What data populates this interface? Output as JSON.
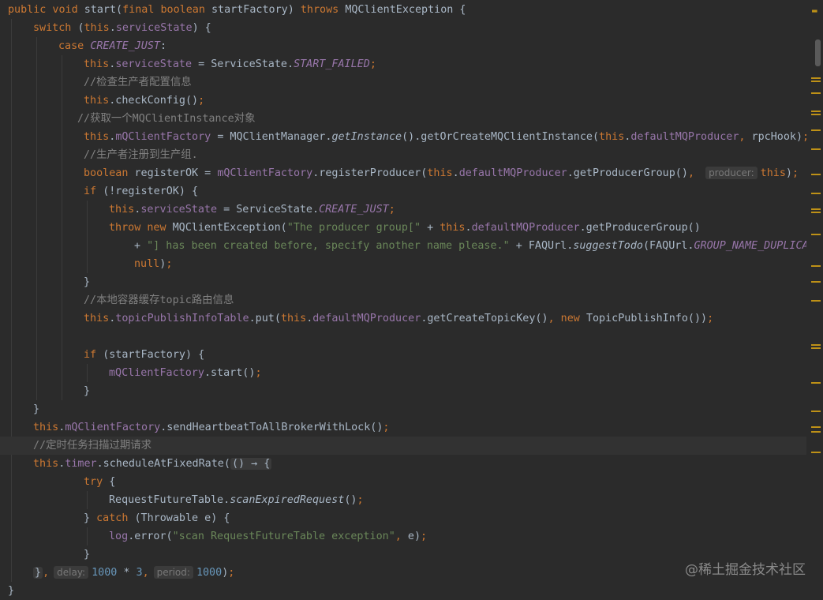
{
  "editor": {
    "lines": [
      {
        "indent": 0,
        "tokens": [
          [
            "kw",
            "public void "
          ],
          [
            "plain",
            "start("
          ],
          [
            "kw",
            "final boolean "
          ],
          [
            "plain",
            "startFactory) "
          ],
          [
            "kw",
            "throws "
          ],
          [
            "plain",
            "MQClientException {"
          ]
        ]
      },
      {
        "indent": 1,
        "tokens": [
          [
            "kw",
            "switch "
          ],
          [
            "plain",
            "("
          ],
          [
            "kw",
            "this"
          ],
          [
            "plain",
            "."
          ],
          [
            "fld",
            "serviceState"
          ],
          [
            "plain",
            ") {"
          ]
        ]
      },
      {
        "indent": 2,
        "tokens": [
          [
            "kw",
            "case "
          ],
          [
            "fld ital",
            "CREATE_JUST"
          ],
          [
            "plain",
            ":"
          ]
        ]
      },
      {
        "indent": 3,
        "tokens": [
          [
            "kw",
            "this"
          ],
          [
            "plain",
            "."
          ],
          [
            "fld",
            "serviceState "
          ],
          [
            "plain",
            "= ServiceState."
          ],
          [
            "fld ital",
            "START_FAILED"
          ],
          [
            "kw",
            ";"
          ]
        ]
      },
      {
        "indent": 3,
        "tokens": [
          [
            "cmt",
            "//检查生产者配置信息"
          ]
        ]
      },
      {
        "indent": 3,
        "tokens": [
          [
            "kw",
            "this"
          ],
          [
            "plain",
            ".checkConfig()"
          ],
          [
            "kw",
            ";"
          ]
        ]
      },
      {
        "indent": 3,
        "offset": -8,
        "tokens": [
          [
            "cmt",
            "//获取一个MQClientInstance对象"
          ]
        ]
      },
      {
        "indent": 3,
        "tokens": [
          [
            "kw",
            "this"
          ],
          [
            "plain",
            "."
          ],
          [
            "fld",
            "mQClientFactory "
          ],
          [
            "plain",
            "= MQClientManager."
          ],
          [
            "plain ital",
            "getInstance"
          ],
          [
            "plain",
            "().getOrCreateMQClientInstance("
          ],
          [
            "kw",
            "this"
          ],
          [
            "plain",
            "."
          ],
          [
            "fld",
            "defaultMQProducer"
          ],
          [
            "kw",
            ", "
          ],
          [
            "plain",
            "rpcHook)"
          ],
          [
            "kw",
            ";"
          ]
        ]
      },
      {
        "indent": 3,
        "tokens": [
          [
            "cmt",
            "//生产者注册到生产组."
          ]
        ]
      },
      {
        "indent": 3,
        "tokens": [
          [
            "kw",
            "boolean "
          ],
          [
            "plain",
            "registerOK = "
          ],
          [
            "fld",
            "mQClientFactory"
          ],
          [
            "plain",
            ".registerProducer("
          ],
          [
            "kw",
            "this"
          ],
          [
            "plain",
            "."
          ],
          [
            "fld",
            "defaultMQProducer"
          ],
          [
            "plain",
            ".getProducerGroup()"
          ],
          [
            "kw",
            ", "
          ],
          [
            "hint",
            "producer:"
          ],
          [
            "kw",
            "this"
          ],
          [
            "plain",
            ")"
          ],
          [
            "kw",
            ";"
          ]
        ]
      },
      {
        "indent": 3,
        "tokens": [
          [
            "kw",
            "if "
          ],
          [
            "plain",
            "(!registerOK) {"
          ]
        ]
      },
      {
        "indent": 4,
        "tokens": [
          [
            "kw",
            "this"
          ],
          [
            "plain",
            "."
          ],
          [
            "fld",
            "serviceState "
          ],
          [
            "plain",
            "= ServiceState."
          ],
          [
            "fld ital",
            "CREATE_JUST"
          ],
          [
            "kw",
            ";"
          ]
        ]
      },
      {
        "indent": 4,
        "tokens": [
          [
            "kw",
            "throw new "
          ],
          [
            "plain",
            "MQClientException("
          ],
          [
            "str",
            "\"The producer group[\" "
          ],
          [
            "plain",
            "+ "
          ],
          [
            "kw",
            "this"
          ],
          [
            "plain",
            "."
          ],
          [
            "fld",
            "defaultMQProducer"
          ],
          [
            "plain",
            ".getProducerGroup()"
          ]
        ]
      },
      {
        "indent": 5,
        "tokens": [
          [
            "plain",
            "+ "
          ],
          [
            "str",
            "\"] has been created before, specify another name please.\" "
          ],
          [
            "plain",
            "+ FAQUrl."
          ],
          [
            "plain ital",
            "suggestTodo"
          ],
          [
            "plain",
            "(FAQUrl."
          ],
          [
            "fld ital",
            "GROUP_NAME_DUPLICATE_URL"
          ],
          [
            "plain",
            ")"
          ]
        ]
      },
      {
        "indent": 5,
        "tokens": [
          [
            "kw",
            "null"
          ],
          [
            "plain",
            ")"
          ],
          [
            "kw",
            ";"
          ]
        ]
      },
      {
        "indent": 3,
        "tokens": [
          [
            "plain",
            "}"
          ]
        ]
      },
      {
        "indent": 3,
        "tokens": [
          [
            "cmt",
            "//本地容器缓存topic路由信息"
          ]
        ]
      },
      {
        "indent": 3,
        "tokens": [
          [
            "kw",
            "this"
          ],
          [
            "plain",
            "."
          ],
          [
            "fld",
            "topicPublishInfoTable"
          ],
          [
            "plain",
            ".put("
          ],
          [
            "kw",
            "this"
          ],
          [
            "plain",
            "."
          ],
          [
            "fld",
            "defaultMQProducer"
          ],
          [
            "plain",
            ".getCreateTopicKey()"
          ],
          [
            "kw",
            ", new "
          ],
          [
            "plain",
            "TopicPublishInfo())"
          ],
          [
            "kw",
            ";"
          ]
        ]
      },
      {
        "indent": 0,
        "tokens": []
      },
      {
        "indent": 3,
        "tokens": [
          [
            "kw",
            "if "
          ],
          [
            "plain",
            "(startFactory) {"
          ]
        ]
      },
      {
        "indent": 4,
        "tokens": [
          [
            "fld",
            "mQClientFactory"
          ],
          [
            "plain",
            ".start()"
          ],
          [
            "kw",
            ";"
          ]
        ]
      },
      {
        "indent": 3,
        "tokens": [
          [
            "plain",
            "}"
          ]
        ]
      },
      {
        "indent": 1,
        "tokens": [
          [
            "plain",
            "}"
          ]
        ]
      },
      {
        "indent": 1,
        "tokens": [
          [
            "kw",
            "this"
          ],
          [
            "plain",
            "."
          ],
          [
            "fld",
            "mQClientFactory"
          ],
          [
            "plain",
            ".sendHeartbeatToAllBrokerWithLock()"
          ],
          [
            "kw",
            ";"
          ]
        ]
      },
      {
        "indent": 1,
        "current": true,
        "tokens": [
          [
            "cmt",
            "//定时任务扫描过期请求"
          ]
        ]
      },
      {
        "indent": 1,
        "tokens": [
          [
            "kw",
            "this"
          ],
          [
            "plain",
            "."
          ],
          [
            "fld",
            "timer"
          ],
          [
            "plain",
            ".scheduleAtFixedRate("
          ],
          [
            "fold",
            "() → {"
          ]
        ]
      },
      {
        "indent": 3,
        "tokens": [
          [
            "kw",
            "try "
          ],
          [
            "plain",
            "{"
          ]
        ]
      },
      {
        "indent": 4,
        "tokens": [
          [
            "plain",
            "RequestFutureTable."
          ],
          [
            "plain ital",
            "scanExpiredRequest"
          ],
          [
            "plain",
            "()"
          ],
          [
            "kw",
            ";"
          ]
        ]
      },
      {
        "indent": 3,
        "tokens": [
          [
            "plain",
            "} "
          ],
          [
            "kw",
            "catch "
          ],
          [
            "plain",
            "(Throwable e) {"
          ]
        ]
      },
      {
        "indent": 4,
        "tokens": [
          [
            "fld",
            "log"
          ],
          [
            "plain",
            ".error("
          ],
          [
            "str",
            "\"scan RequestFutureTable exception\""
          ],
          [
            "kw",
            ", "
          ],
          [
            "plain",
            "e)"
          ],
          [
            "kw",
            ";"
          ]
        ]
      },
      {
        "indent": 3,
        "tokens": [
          [
            "plain",
            "}"
          ]
        ]
      },
      {
        "indent": 1,
        "tokens": [
          [
            "fold",
            "}"
          ],
          [
            "kw",
            ","
          ],
          [
            "hint",
            "delay:"
          ],
          [
            "num",
            "1000 "
          ],
          [
            "plain",
            "* "
          ],
          [
            "num",
            "3"
          ],
          [
            "kw",
            ","
          ],
          [
            "hint",
            "period:"
          ],
          [
            "num",
            "1000"
          ],
          [
            "plain",
            ")"
          ],
          [
            "kw",
            ";"
          ]
        ]
      },
      {
        "indent": 0,
        "tokens": [
          [
            "plain",
            "}"
          ]
        ]
      }
    ]
  },
  "scrollbar": {
    "markers": [
      "warning",
      "warning",
      "warning",
      "warning",
      "warning",
      "warning",
      "warning",
      "warning",
      "warning",
      "warning",
      "warning",
      "warning",
      "warning",
      "warning",
      "warning",
      "warning",
      "warning",
      "warning",
      "warning",
      "warning",
      "warning",
      "warning"
    ]
  },
  "colors": {
    "background": "#2b2b2b",
    "keyword": "#cc7832",
    "field": "#9876aa",
    "string": "#6a8759",
    "comment": "#808080",
    "number": "#6897bb",
    "default": "#a9b7c6",
    "warning": "#be9117"
  },
  "watermark": "@稀土掘金技术社区"
}
